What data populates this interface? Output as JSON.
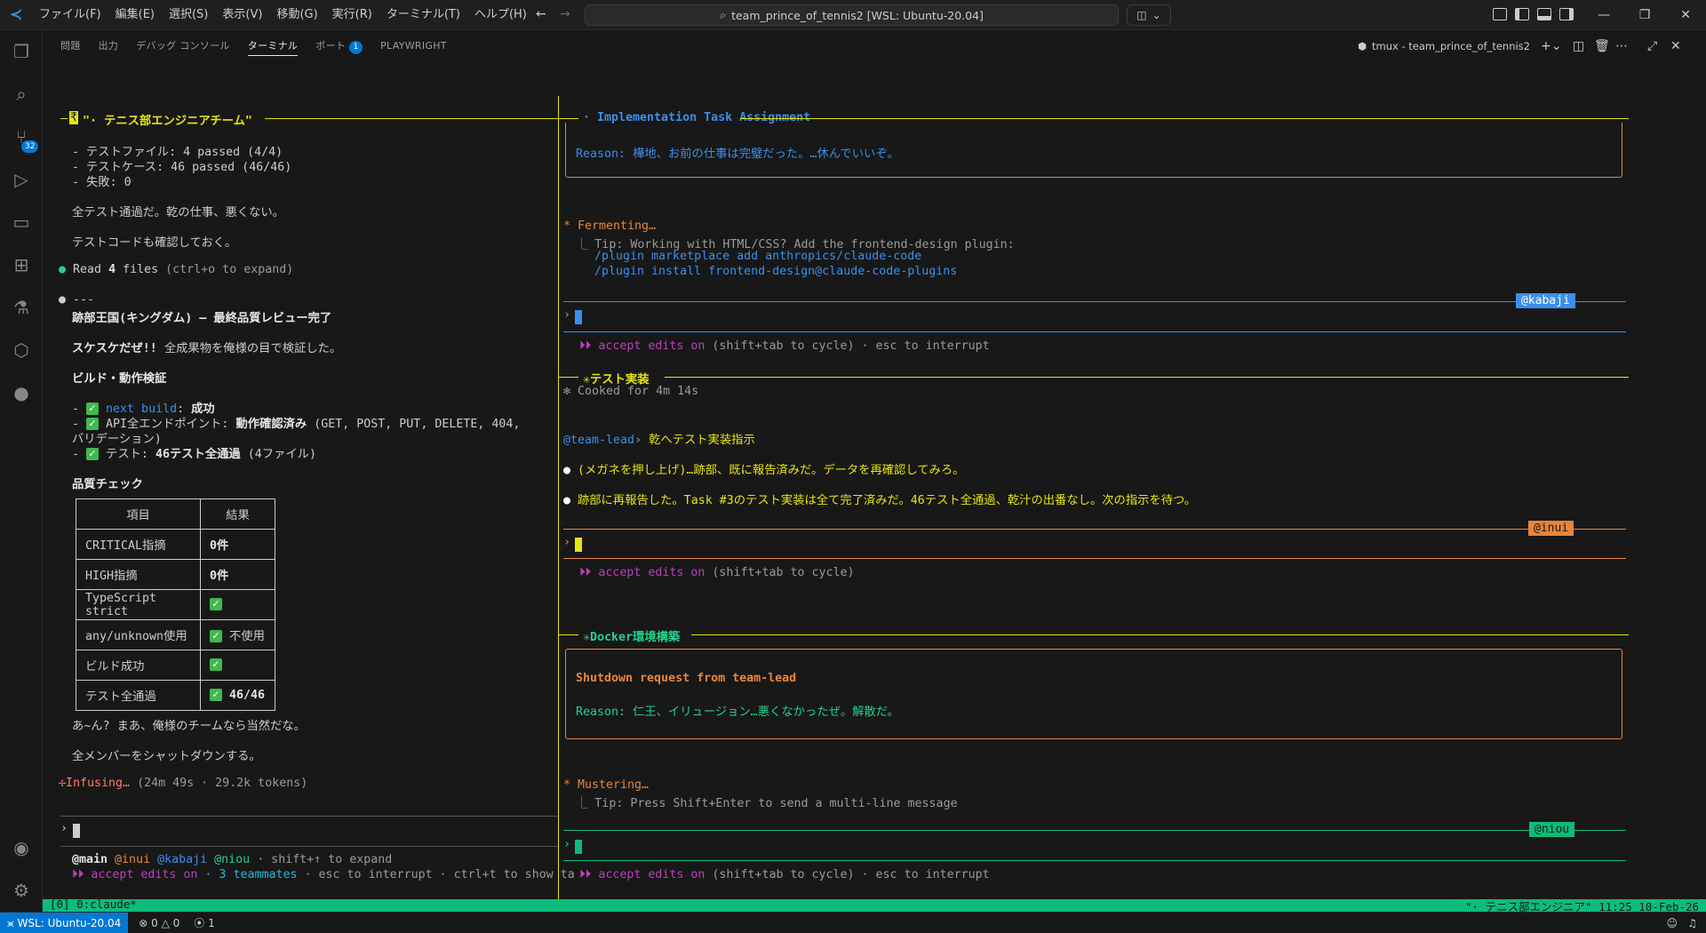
{
  "colors": {
    "accent": "#0078d4",
    "tmux_green": "#0dbc79",
    "yellow": "#e5e510",
    "orange": "#e8853a",
    "blue": "#3b8eea",
    "green": "#23d18b"
  },
  "titlebar": {
    "menu": [
      "ファイル(F)",
      "編集(E)",
      "選択(S)",
      "表示(V)",
      "移動(G)",
      "実行(R)",
      "ターミナル(T)",
      "ヘルプ(H)"
    ],
    "search_text": "team_prince_of_tennis2 [WSL: Ubuntu-20.04]"
  },
  "activity": {
    "scm_badge": "32"
  },
  "panel": {
    "tabs": [
      "問題",
      "出力",
      "デバッグ コンソール",
      "ターミナル",
      "ポート",
      "PLAYWRIGHT"
    ],
    "ports_badge": "1",
    "terminal_name": "tmux - team_prince_of_tennis2"
  },
  "left_pane": {
    "header": "\"· テニス部エンジニアチーム\"",
    "header_mark": "₹",
    "lines": {
      "l1": "- テストファイル: 4 passed (4/4)",
      "l2": "- テストケース: 46 passed (46/46)",
      "l3": "- 失敗: 0",
      "l4": "全テスト通過だ。乾の仕事、悪くない。",
      "l5": "テストコードも確認しておく。",
      "l6a": "Read",
      "l6b": "4",
      "l6c": "files",
      "l6d": "(ctrl+o to expand)",
      "l7": "---",
      "l8": "跡部王国(キングダム) — 最終品質レビュー完了",
      "l9a": "スケスケだぜ!!",
      "l9b": "全成果物を俺様の目で検証した。",
      "l10": "ビルド・動作検証",
      "l11a": "next build",
      "l11b": ": ",
      "l11c": "成功",
      "l12a": "API全エンドポイント: ",
      "l12b": "動作確認済み",
      "l12c": "(GET, POST, PUT, DELETE, 404,",
      "l13": "バリデーション)",
      "l14a": "テスト: ",
      "l14b": "46テスト全通過",
      "l14c": "(4ファイル)",
      "l15": "品質チェック",
      "l16": "あ~ん? まあ、俺様のチームなら当然だな。",
      "l17": "全メンバーをシャットダウンする。",
      "l18a": "Infusing…",
      "l18b": "(24m 49s · 29.2k tokens)"
    },
    "table": {
      "headers": [
        "項目",
        "結果"
      ],
      "rows": [
        [
          "CRITICAL指摘",
          "0件"
        ],
        [
          "HIGH指摘",
          "0件"
        ],
        [
          "TypeScript strict",
          ""
        ],
        [
          "any/unknown使用",
          "不使用"
        ],
        [
          "ビルド成功",
          ""
        ],
        [
          "テスト全通過",
          "46/46"
        ]
      ]
    },
    "footer": {
      "main": "@main",
      "inui": "@inui",
      "kabaji": "@kabaji",
      "niou": "@niou",
      "expand": "· shift+↑ to expand",
      "accept": "accept edits on",
      "teammates": "· 3 teammates",
      "rest": "· esc to interrupt · ctrl+t to show ta"
    }
  },
  "right_pane": {
    "p1": {
      "header": "· Implementation Task Assignment",
      "reason_label": "Reason: ",
      "reason": "樺地、お前の仕事は完璧だった。…休んでいいぞ。",
      "fermenting": "* Fermenting…",
      "tip": "⎿ Tip: Working with HTML/CSS? Add the frontend-design plugin:",
      "cmd1": "/plugin marketplace add anthropics/claude-code",
      "cmd2": "/plugin install frontend-design@claude-code-plugins",
      "tag": "@kabaji",
      "accept": "accept edits on",
      "hint": "(shift+tab to cycle) · esc to interrupt"
    },
    "p2": {
      "header": "✳テスト実装",
      "cooked": "✻ Cooked for 4m 14s",
      "lead": "@team-lead",
      "lead_msg": "乾へテスト実装指示",
      "msg1": "(メガネを押し上げ)…跡部、既に報告済みだ。データを再確認してみろ。",
      "msg2": "跡部に再報告した。Task #3のテスト実装は全て完了済みだ。46テスト全通過、乾汁の出番なし。次の指示を待つ。",
      "tag": "@inui",
      "accept": "accept edits on",
      "hint": "(shift+tab to cycle)"
    },
    "p3": {
      "header": "✳Docker環境構築",
      "shutdown": "Shutdown request from team-lead",
      "reason_label": "Reason: ",
      "reason": "仁王、イリュージョン…悪くなかったぜ。解散だ。",
      "mustering": "* Mustering…",
      "tip": "⎿ Tip: Press Shift+Enter to send a multi-line message",
      "tag": "@niou",
      "accept": "accept edits on",
      "hint": "(shift+tab to cycle) · esc to interrupt"
    }
  },
  "tmux": {
    "left": "[0] 0:claude*",
    "right": "\"· テニス部エンジニア\" 11:25 10-Feb-26"
  },
  "statusbar": {
    "remote": "WSL: Ubuntu-20.04",
    "errors": "0",
    "warnings": "0",
    "ports": "1"
  }
}
